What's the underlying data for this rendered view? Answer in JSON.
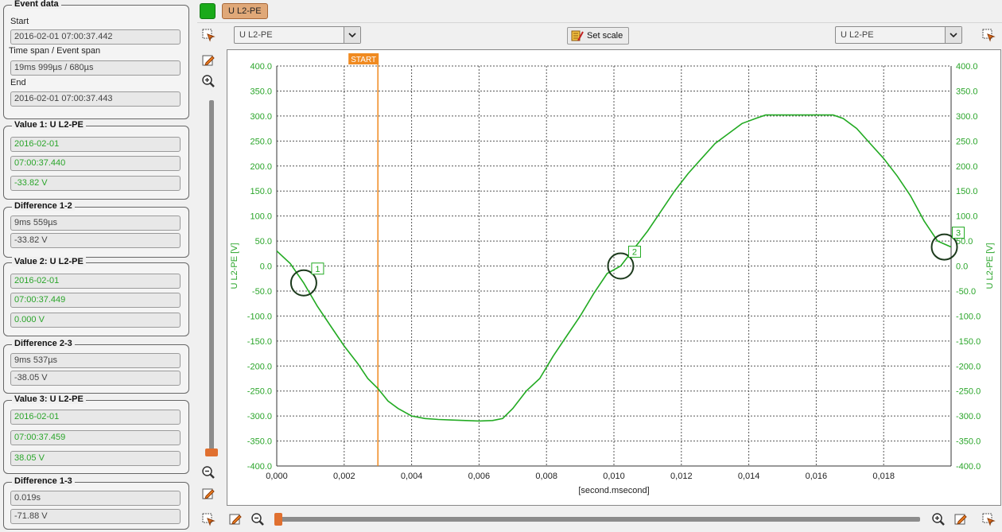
{
  "event_data": {
    "title": "Event data",
    "start_label": "Start",
    "start_value": "2016-02-01 07:00:37.442",
    "span_label": "Time span / Event span",
    "span_value": "19ms 999µs  / 680µs",
    "end_label": "End",
    "end_value": "2016-02-01 07:00:37.443"
  },
  "value1": {
    "title": "Value 1: U L2-PE",
    "date": "2016-02-01",
    "time": "07:00:37.440",
    "value": "-33.82 V"
  },
  "diff12": {
    "title": "Difference 1-2",
    "time": "9ms 559µs",
    "value": "-33.82 V"
  },
  "value2": {
    "title": "Value 2: U L2-PE",
    "date": "2016-02-01",
    "time": "07:00:37.449",
    "value": "0.000 V"
  },
  "diff23": {
    "title": "Difference 2-3",
    "time": "9ms 537µs",
    "value": "-38.05 V"
  },
  "value3": {
    "title": "Value 3: U L2-PE",
    "date": "2016-02-01",
    "time": "07:00:37.459",
    "value": "38.05 V"
  },
  "diff13": {
    "title": "Difference 1-3",
    "time": "0.019s",
    "value": "-71.88 V"
  },
  "channel_tag": "U L2-PE",
  "left_combo": "U L2-PE",
  "right_combo": "U L2-PE",
  "set_scale_label": "Set scale",
  "colors": {
    "series": "#22aa22",
    "start_marker": "#f08a20",
    "cursor_circle": "#1c3a1c",
    "active_channel": "#1aaa1a"
  },
  "chart_data": {
    "type": "line",
    "ylabel_left": "U L2-PE [V]",
    "ylabel_right": "U L2-PE [V]",
    "xlabel": "[second.msecond]",
    "xlim": [
      0,
      0.02
    ],
    "ylim": [
      -400,
      400
    ],
    "x_ticks": [
      "0,000",
      "0,002",
      "0,004",
      "0,006",
      "0,008",
      "0,010",
      "0,012",
      "0,014",
      "0,016",
      "0,018"
    ],
    "x_tick_values": [
      0,
      0.002,
      0.004,
      0.006,
      0.008,
      0.01,
      0.012,
      0.014,
      0.016,
      0.018
    ],
    "y_ticks": [
      "400.0",
      "350.0",
      "300.0",
      "250.0",
      "200.0",
      "150.0",
      "100.0",
      "50.0",
      "0.0",
      "-50.0",
      "-100.0",
      "-150.0",
      "-200.0",
      "-250.0",
      "-300.0",
      "-350.0",
      "-400.0"
    ],
    "y_tick_values": [
      400,
      350,
      300,
      250,
      200,
      150,
      100,
      50,
      0,
      -50,
      -100,
      -150,
      -200,
      -250,
      -300,
      -350,
      -400
    ],
    "grid": true,
    "start_marker": {
      "label": "START",
      "x": 0.003
    },
    "series": [
      {
        "name": "U L2-PE",
        "x": [
          0,
          0.0004,
          0.0008,
          0.0012,
          0.0016,
          0.002,
          0.0024,
          0.0027,
          0.003,
          0.0033,
          0.0036,
          0.004,
          0.0044,
          0.0048,
          0.0052,
          0.0056,
          0.006,
          0.0064,
          0.0067,
          0.007,
          0.0074,
          0.0078,
          0.0082,
          0.0086,
          0.009,
          0.0094,
          0.0098,
          0.0102,
          0.0106,
          0.011,
          0.0114,
          0.0118,
          0.0122,
          0.0126,
          0.013,
          0.0134,
          0.0138,
          0.0142,
          0.0145,
          0.0148,
          0.0152,
          0.0156,
          0.016,
          0.0165,
          0.0168,
          0.0172,
          0.0176,
          0.018,
          0.0184,
          0.0188,
          0.0192,
          0.0196,
          0.02
        ],
        "y": [
          30,
          5,
          -33.82,
          -80,
          -120,
          -160,
          -195,
          -225,
          -245,
          -270,
          -285,
          -300,
          -305,
          -307,
          -308,
          -309,
          -310,
          -309,
          -305,
          -285,
          -250,
          -225,
          -180,
          -140,
          -100,
          -55,
          -15,
          0,
          35,
          70,
          110,
          150,
          185,
          215,
          245,
          265,
          285,
          295,
          302,
          302,
          302,
          302,
          302,
          302,
          295,
          275,
          245,
          215,
          180,
          140,
          90,
          50,
          38.05
        ]
      }
    ],
    "cursors": [
      {
        "label": "1",
        "x": 0.0008,
        "y": -33.82
      },
      {
        "label": "2",
        "x": 0.0102,
        "y": 0
      },
      {
        "label": "3",
        "x": 0.0198,
        "y": 38.05
      }
    ]
  }
}
